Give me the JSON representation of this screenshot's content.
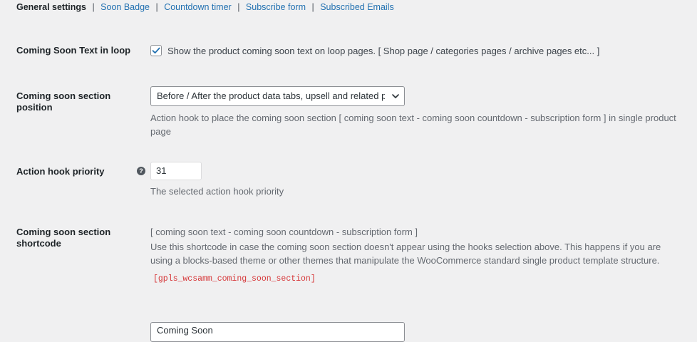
{
  "subnav": {
    "current": "General settings",
    "links": [
      "Soon Badge",
      "Countdown timer",
      "Subscribe form",
      "Subscribed Emails"
    ]
  },
  "rows": {
    "loop_text": {
      "label": "Coming Soon Text in loop",
      "checkbox_checked": true,
      "checkbox_label": "Show the product coming soon text on loop pages. [ Shop page / categories pages / archive pages etc... ]"
    },
    "section_position": {
      "label": "Coming soon section position",
      "selected": "Before / After the product data tabs, upsell and related products",
      "description": "Action hook to place the coming soon section [ coming soon text - coming soon countdown - subscription form ] in single product page"
    },
    "hook_priority": {
      "label": "Action hook priority",
      "help_icon": "help-icon",
      "value": "31",
      "description": "The selected action hook priority"
    },
    "shortcode": {
      "label": "Coming soon section shortcode",
      "line1": "[ coming soon text - coming soon countdown - subscription form ]",
      "description": "Use this shortcode in case the coming soon section doesn't appear using the hooks selection above. This happens if you are using a blocks-based theme or other themes that manipulate the WooCommerce standard single product template structure.",
      "code": "[gpls_wcsamm_coming_soon_section]"
    },
    "next_field": {
      "value": "Coming Soon"
    }
  },
  "colors": {
    "background": "#f0f0f1",
    "link": "#2271b1",
    "code": "#d63638",
    "label": "#1d2327",
    "description": "#646970"
  }
}
